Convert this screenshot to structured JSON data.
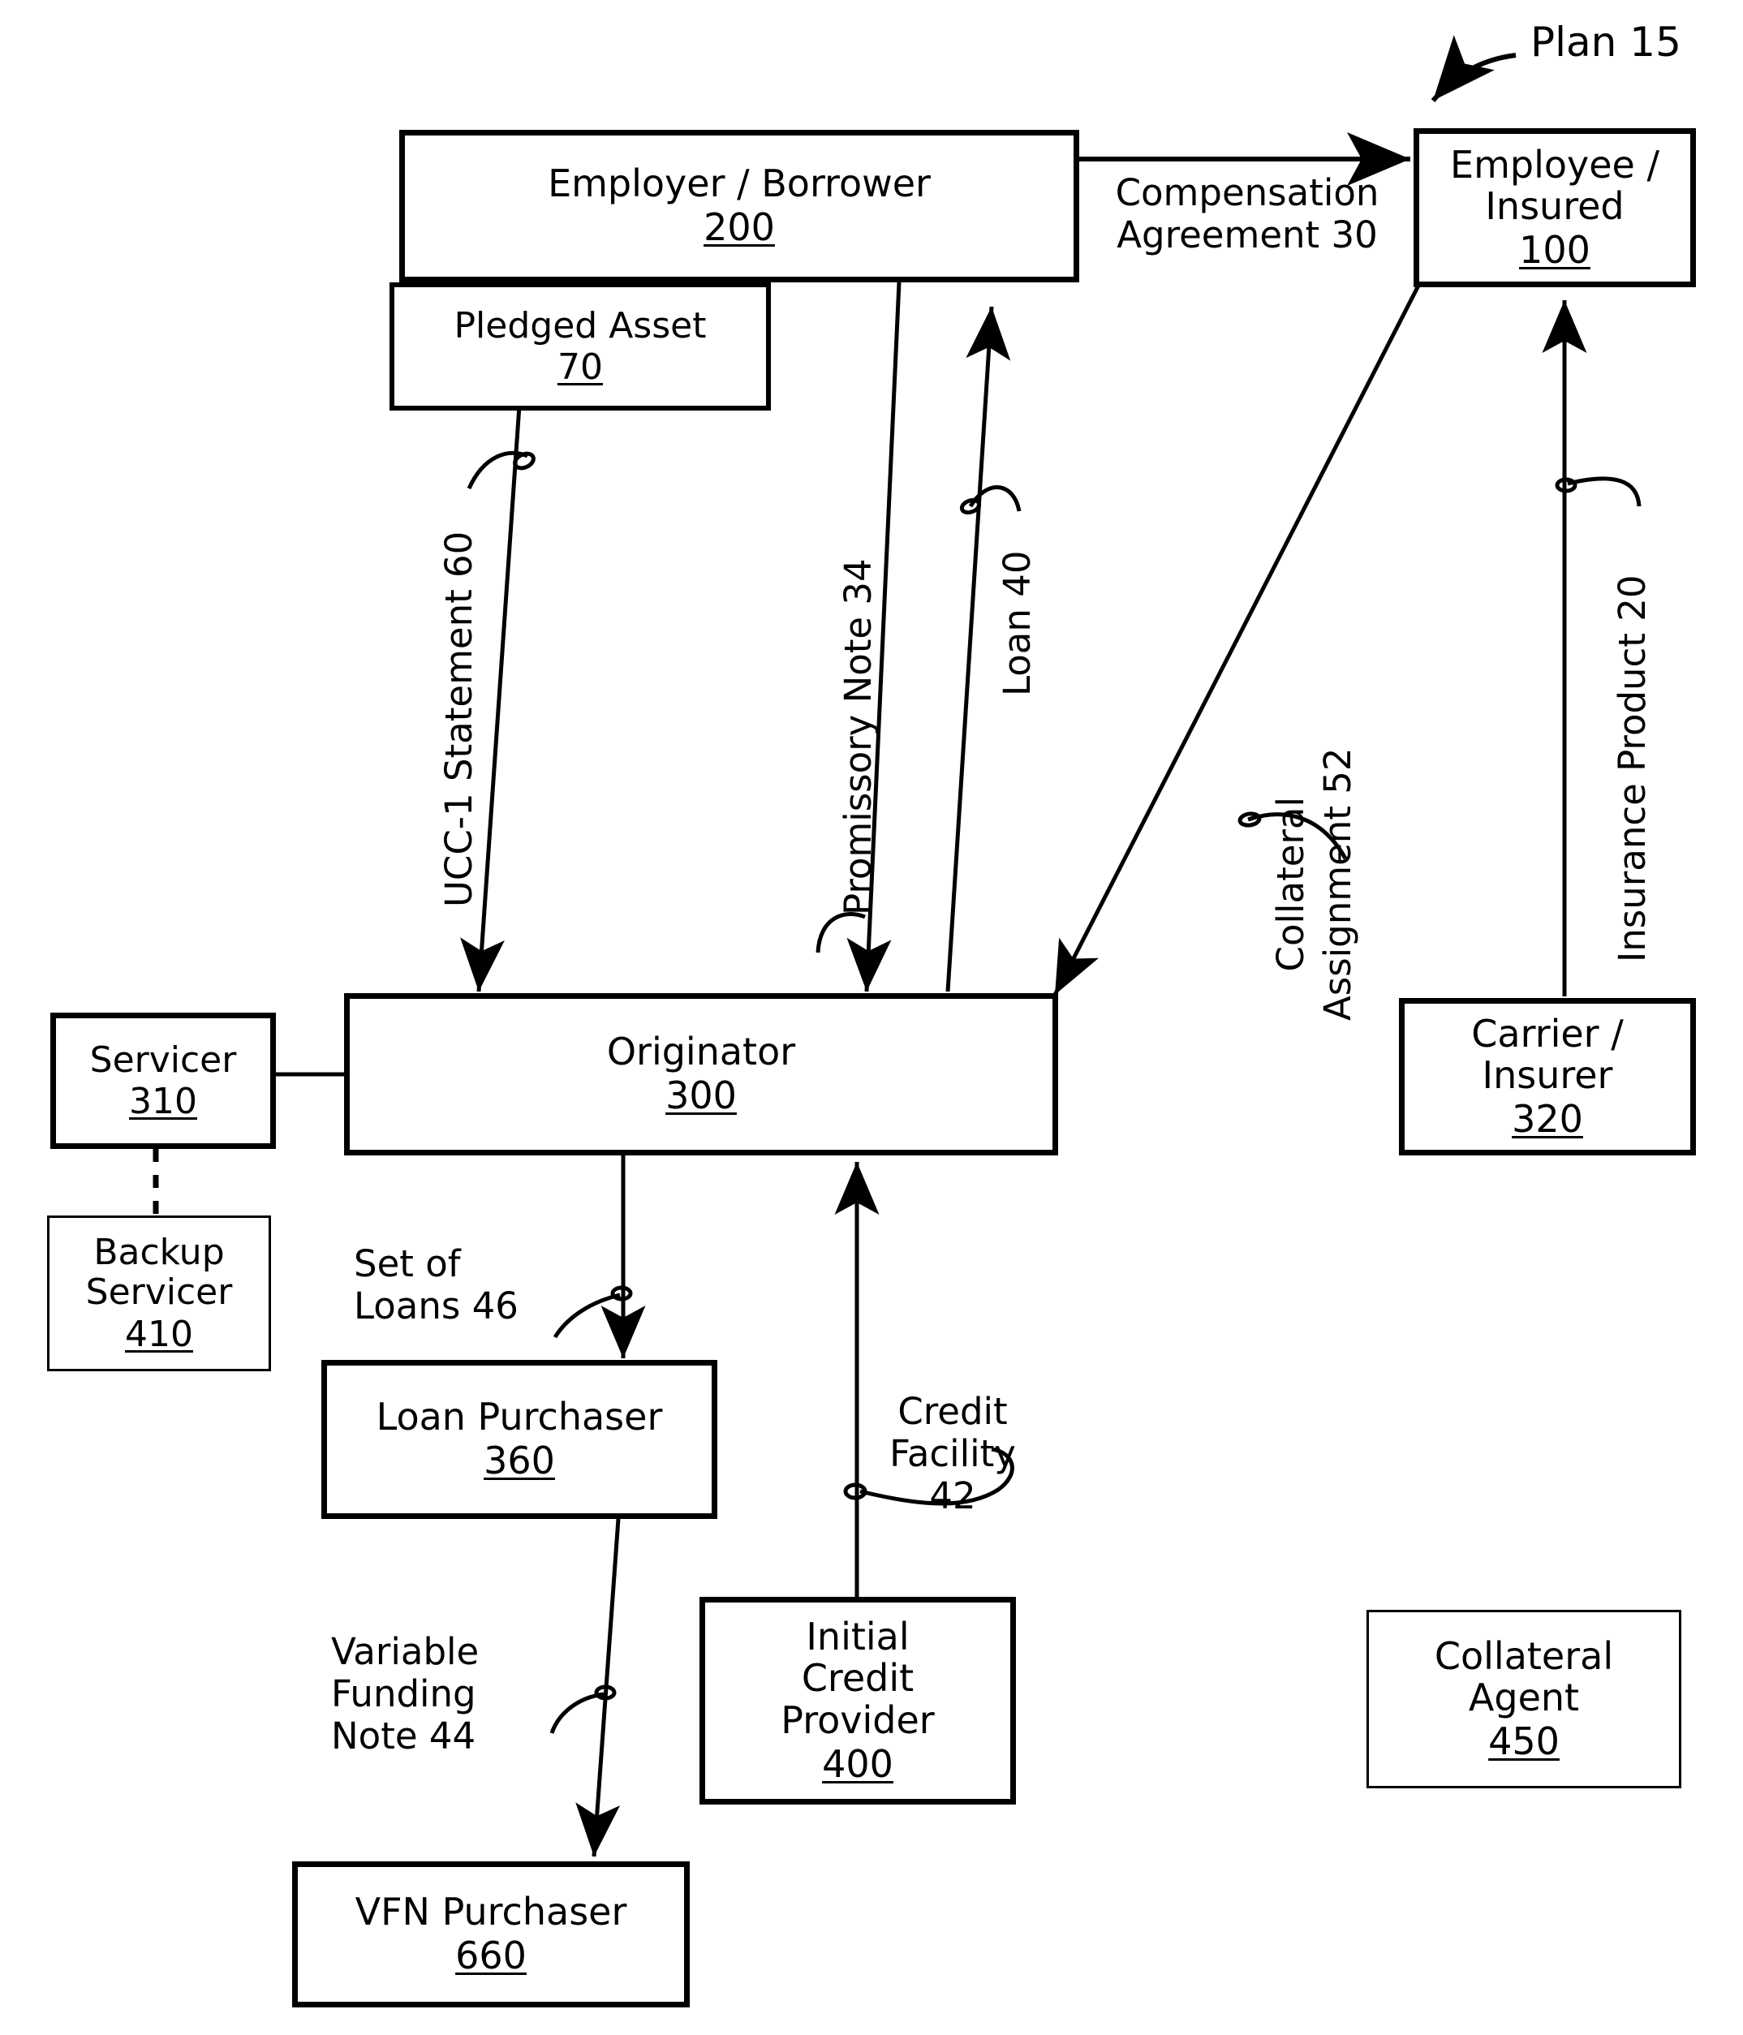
{
  "figure": {
    "title_annotation": "Plan 15",
    "domain": "patent-flow-diagram"
  },
  "nodes": {
    "employer_borrower": {
      "label": "Employer / Borrower",
      "ref": "200"
    },
    "pledged_asset": {
      "label": "Pledged Asset",
      "ref": "70"
    },
    "employee_insured": {
      "label": "Employee /\nInsured",
      "ref": "100"
    },
    "servicer": {
      "label": "Servicer",
      "ref": "310"
    },
    "originator": {
      "label": "Originator",
      "ref": "300"
    },
    "carrier_insurer": {
      "label": "Carrier /\nInsurer",
      "ref": "320"
    },
    "backup_servicer": {
      "label": "Backup\nServicer",
      "ref": "410"
    },
    "loan_purchaser": {
      "label": "Loan Purchaser",
      "ref": "360"
    },
    "initial_credit_provider": {
      "label": "Initial\nCredit\nProvider",
      "ref": "400"
    },
    "collateral_agent": {
      "label": "Collateral\nAgent",
      "ref": "450"
    },
    "vfn_purchaser": {
      "label": "VFN Purchaser",
      "ref": "660"
    }
  },
  "edge_labels": {
    "compensation_agreement": "Compensation\nAgreement 30",
    "ucc1_statement": "UCC-1 Statement 60",
    "promissory_note": "Promissory Note 34",
    "loan": "Loan 40",
    "collateral_assignment": "Collateral\nAssignment 52",
    "insurance_product": "Insurance Product 20",
    "set_of_loans": "Set of\nLoans 46",
    "credit_facility": "Credit\nFacility\n42",
    "variable_funding_note": "Variable\nFunding\nNote 44"
  },
  "colors": {
    "ink": "#000000",
    "paper": "#ffffff"
  }
}
